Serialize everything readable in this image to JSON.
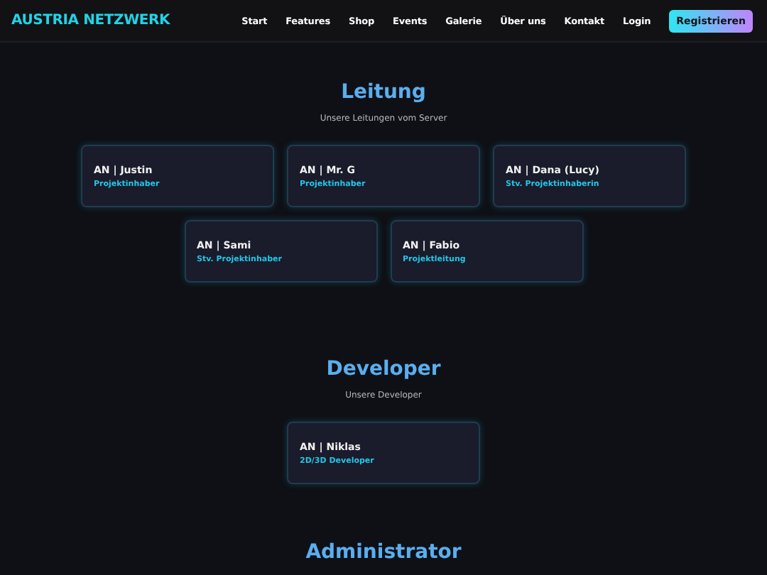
{
  "brand": "AUSTRIA NETZWERK",
  "nav": [
    "Start",
    "Features",
    "Shop",
    "Events",
    "Galerie",
    "Über uns",
    "Kontakt",
    "Login"
  ],
  "cta": "Registrieren",
  "sections": [
    {
      "title": "Leitung",
      "subtitle": "Unsere Leitungen vom Server",
      "members": [
        {
          "name": "AN | Justin",
          "role": "Projektinhaber"
        },
        {
          "name": "AN | Mr. G",
          "role": "Projektinhaber"
        },
        {
          "name": "AN | Dana (Lucy)",
          "role": "Stv. Projektinhaberin"
        },
        {
          "name": "AN | Sami",
          "role": "Stv. Projektinhaber"
        },
        {
          "name": "AN | Fabio",
          "role": "Projektleitung"
        }
      ]
    },
    {
      "title": "Developer",
      "subtitle": "Unsere Developer",
      "members": [
        {
          "name": "AN | Niklas",
          "role": "2D/3D Developer"
        }
      ]
    },
    {
      "title": "Administrator"
    }
  ]
}
